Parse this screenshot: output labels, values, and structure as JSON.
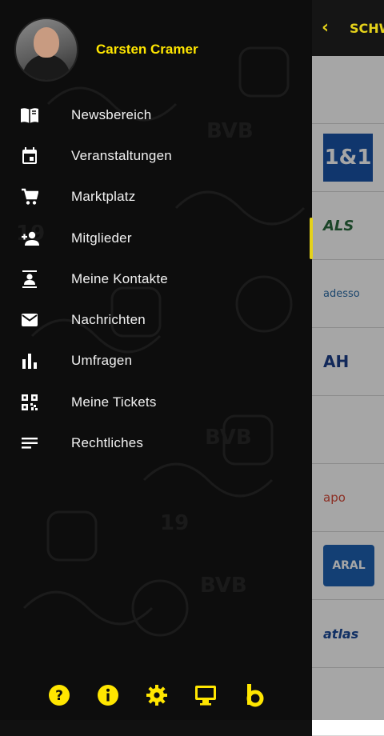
{
  "profile": {
    "name": "Carsten Cramer"
  },
  "menu": {
    "items": [
      {
        "label": "Newsbereich",
        "icon": "book-icon"
      },
      {
        "label": "Veranstaltungen",
        "icon": "calendar-icon"
      },
      {
        "label": "Marktplatz",
        "icon": "cart-icon"
      },
      {
        "label": "Mitglieder",
        "icon": "add-person-icon"
      },
      {
        "label": "Meine Kontakte",
        "icon": "contacts-icon"
      },
      {
        "label": "Nachrichten",
        "icon": "mail-icon"
      },
      {
        "label": "Umfragen",
        "icon": "bar-chart-icon"
      },
      {
        "label": "Meine Tickets",
        "icon": "qr-code-icon"
      },
      {
        "label": "Rechtliches",
        "icon": "notes-icon"
      }
    ]
  },
  "bottom_bar": [
    "help-icon",
    "info-icon",
    "settings-icon",
    "monitor-icon",
    "brand-b-icon"
  ],
  "behind_page": {
    "title": "SCHW",
    "logos": [
      "",
      "1&1",
      "ALS",
      "adesso",
      "AH",
      "",
      "apo",
      "ARAL",
      "atlas",
      ""
    ]
  },
  "colors": {
    "accent": "#ffe600",
    "drawer_bg": "#0d0d0d",
    "text": "#f2f2f2"
  }
}
